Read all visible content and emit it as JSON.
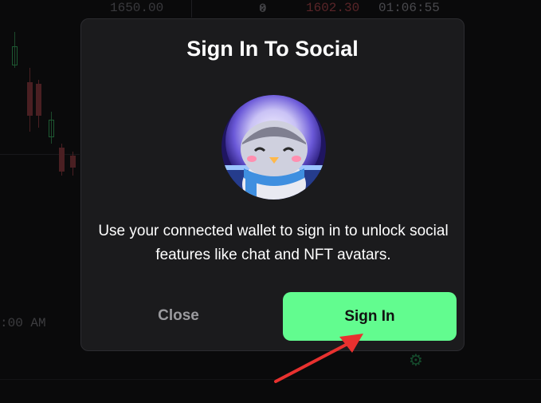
{
  "background": {
    "price_left": "1650.00",
    "count": "0",
    "price_red": "1602.30",
    "timer": "01:06:55",
    "time_label": ":00 AM"
  },
  "modal": {
    "title": "Sign In To Social",
    "description": "Use your connected wallet to sign in to unlock social features like chat and NFT avatars.",
    "close_label": "Close",
    "signin_label": "Sign In"
  },
  "colors": {
    "accent": "#62fc8f",
    "modal_bg": "#1b1b1d",
    "annotation_arrow": "#e8312f"
  }
}
